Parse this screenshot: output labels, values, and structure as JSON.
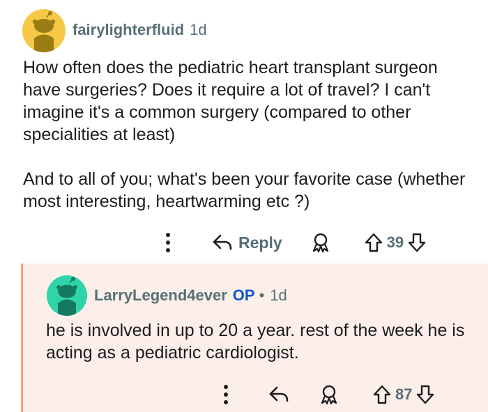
{
  "comments": [
    {
      "username": "fairylighterfluid",
      "time": "1d",
      "body": "How often does the pediatric heart transplant surgeon have surgeries? Does it require a lot of travel? I can't imagine it's a common surgery (compared to other specialities at least)\n\nAnd to all of you; what's been your favorite case (whether most interesting, heartwarming etc ?)",
      "reply_label": "Reply",
      "votes": "39",
      "avatar_color": "#f6c845"
    },
    {
      "username": "LarryLegend4ever",
      "op_badge": "OP",
      "separator": "•",
      "time": "1d",
      "body": "he is involved in up to 20 a year. rest of the week he is acting as a pediatric cardiologist.",
      "votes": "87",
      "avatar_color": "#2fd5a9",
      "thread_line_color": "#f4a27c",
      "background_color": "#fcefea"
    }
  ],
  "colors": {
    "meta_gray": "#576f76",
    "op_blue": "#0a58ca",
    "text": "#1c1c1c"
  }
}
